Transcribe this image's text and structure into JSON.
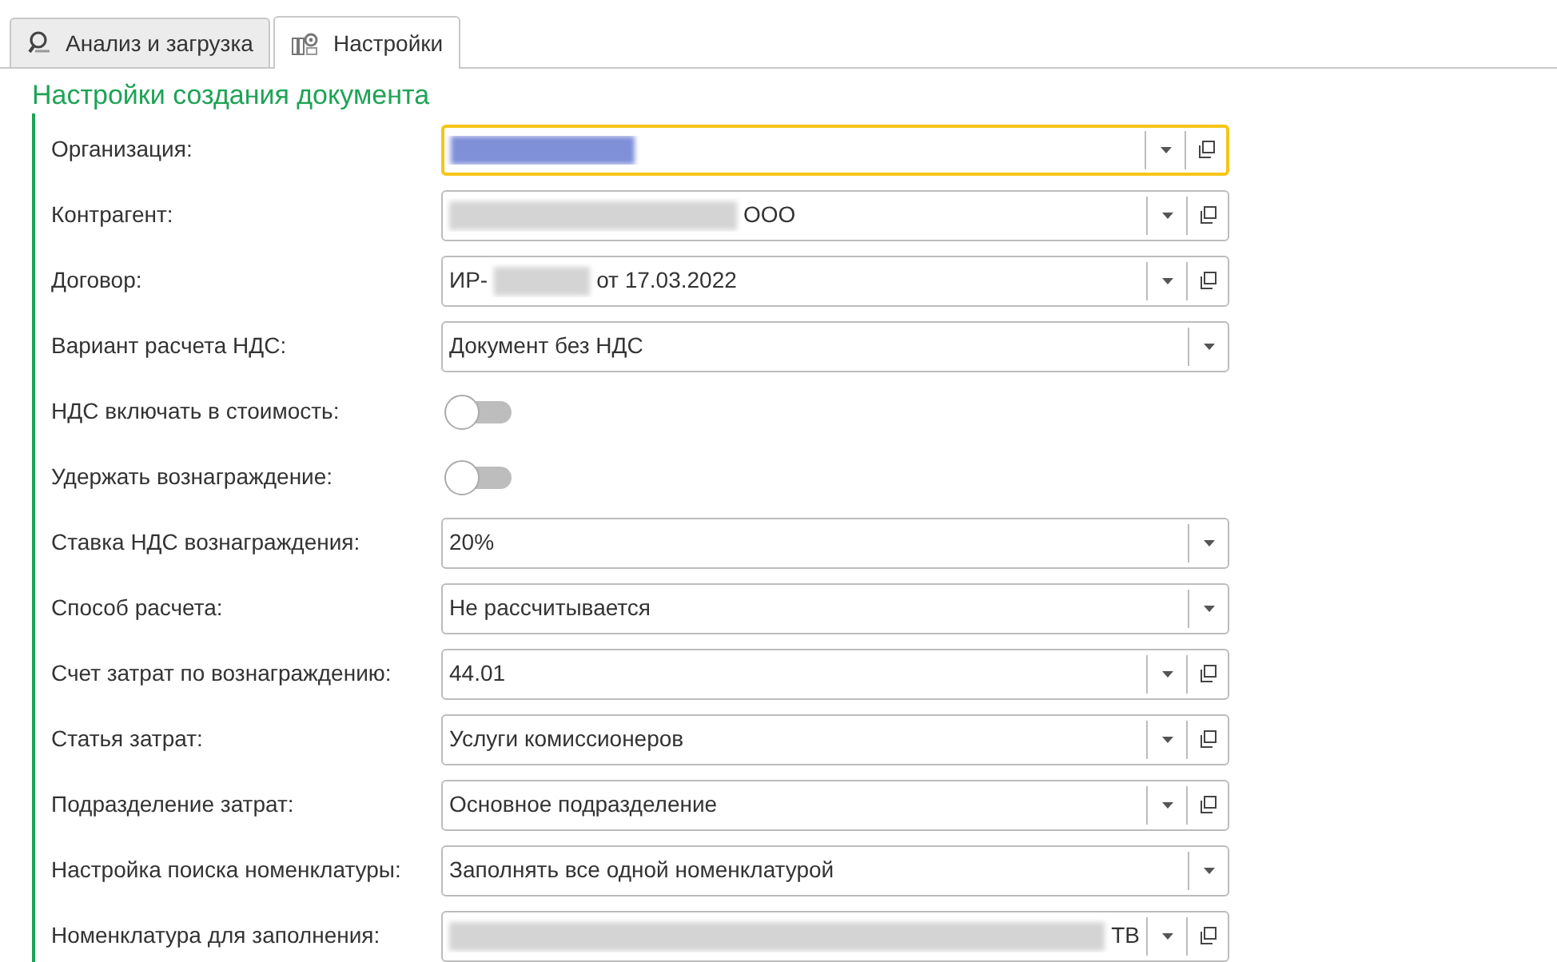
{
  "tabs": [
    {
      "label": "Анализ и загрузка",
      "selected": false
    },
    {
      "label": "Настройки",
      "selected": true
    }
  ],
  "section": {
    "title": "Настройки создания документа"
  },
  "rows": [
    {
      "kind": "field",
      "label": "Организация:",
      "focused": true,
      "open_button": true,
      "value": [
        {
          "kind": "redacted"
        }
      ]
    },
    {
      "kind": "field",
      "label": "Контрагент:",
      "focused": false,
      "open_button": true,
      "value": [
        {
          "kind": "redacted"
        },
        {
          "kind": "text",
          "text": "ООО"
        }
      ]
    },
    {
      "kind": "field",
      "label": "Договор:",
      "focused": false,
      "open_button": true,
      "value": [
        {
          "kind": "text",
          "text": "ИР-"
        },
        {
          "kind": "redacted"
        },
        {
          "kind": "text",
          "text": "от 17.03.2022"
        }
      ]
    },
    {
      "kind": "field",
      "label": "Вариант расчета НДС:",
      "focused": false,
      "open_button": false,
      "value": [
        {
          "kind": "text",
          "text": "Документ без НДС"
        }
      ]
    },
    {
      "kind": "toggle",
      "label": "НДС включать в стоимость:",
      "on": false
    },
    {
      "kind": "toggle",
      "label": "Удержать вознаграждение:",
      "on": false
    },
    {
      "kind": "field",
      "label": "Ставка НДС вознаграждения:",
      "focused": false,
      "open_button": false,
      "value": [
        {
          "kind": "text",
          "text": "20%"
        }
      ]
    },
    {
      "kind": "field",
      "label": "Способ расчета:",
      "focused": false,
      "open_button": false,
      "value": [
        {
          "kind": "text",
          "text": "Не рассчитывается"
        }
      ]
    },
    {
      "kind": "field",
      "label": "Счет затрат по вознаграждению:",
      "focused": false,
      "open_button": true,
      "value": [
        {
          "kind": "text",
          "text": "44.01"
        }
      ]
    },
    {
      "kind": "field",
      "label": "Статья затрат:",
      "focused": false,
      "open_button": true,
      "value": [
        {
          "kind": "text",
          "text": "Услуги комиссионеров"
        }
      ]
    },
    {
      "kind": "field",
      "label": "Подразделение затрат:",
      "focused": false,
      "open_button": true,
      "value": [
        {
          "kind": "text",
          "text": "Основное подразделение"
        }
      ]
    },
    {
      "kind": "field",
      "label": "Настройка поиска номенклатуры:",
      "focused": false,
      "open_button": false,
      "value": [
        {
          "kind": "text",
          "text": "Заполнять все одной номенклатурой"
        }
      ]
    },
    {
      "kind": "field",
      "label": "Номенклатура для заполнения:",
      "focused": false,
      "open_button": true,
      "value": [
        {
          "kind": "redacted"
        },
        {
          "kind": "text",
          "text": "ТВ"
        }
      ]
    }
  ]
}
